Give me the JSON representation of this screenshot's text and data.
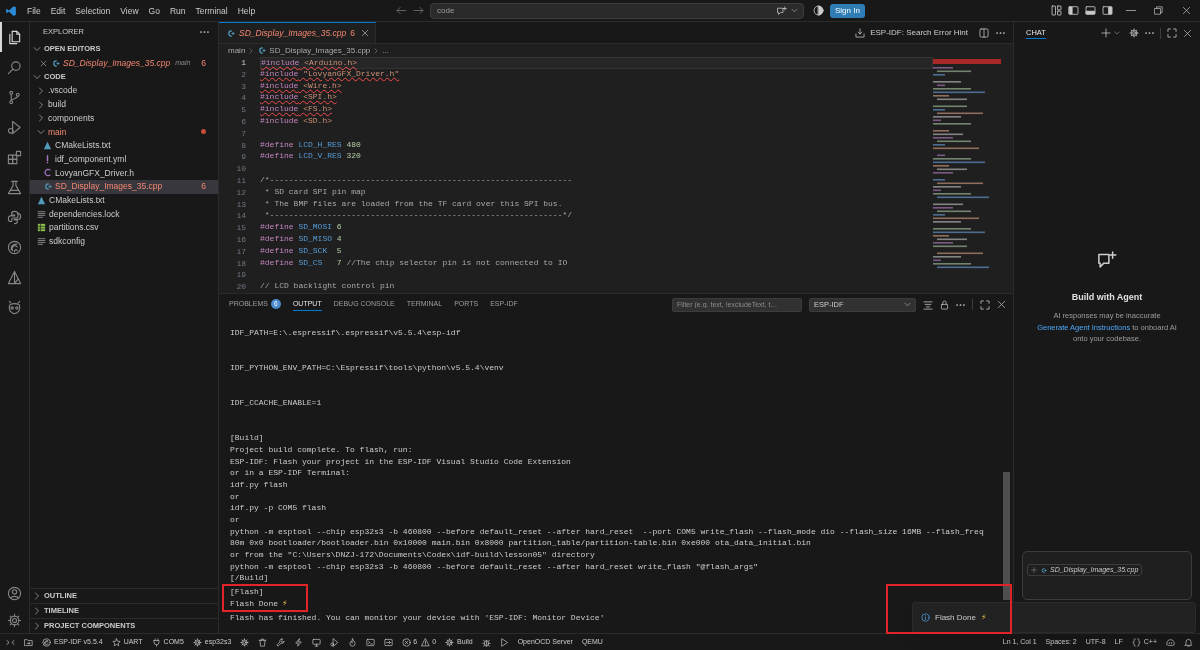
{
  "title_bar": {
    "menu": [
      "File",
      "Edit",
      "Selection",
      "View",
      "Go",
      "Run",
      "Terminal",
      "Help"
    ],
    "command_center": {
      "value": "code"
    },
    "sign_in": "Sign In"
  },
  "activity_bar": {
    "items": [
      {
        "kind": "explorer",
        "selected": true
      },
      {
        "kind": "search",
        "selected": false
      },
      {
        "kind": "source-control",
        "selected": false
      },
      {
        "kind": "run-debug",
        "selected": false
      },
      {
        "kind": "extensions",
        "selected": false
      },
      {
        "kind": "testing",
        "selected": false
      },
      {
        "kind": "python",
        "selected": false
      },
      {
        "kind": "esp-idf",
        "selected": false
      },
      {
        "kind": "cmake",
        "selected": false
      },
      {
        "kind": "alien",
        "selected": false
      }
    ]
  },
  "sidebar": {
    "title": "EXPLORER",
    "sections": [
      {
        "label": "OPEN EDITORS",
        "expanded": true,
        "editors": [
          {
            "name": "SD_Display_Images_35.cpp",
            "kind": "cpp",
            "folder": "main",
            "problems": "6",
            "error": true
          }
        ]
      },
      {
        "label": "CODE",
        "expanded": true,
        "tree": [
          {
            "name": ".vscode",
            "kind": "folder",
            "expanded": false,
            "selected": false,
            "error": false
          },
          {
            "name": "build",
            "kind": "folder",
            "expanded": false,
            "selected": false,
            "error": false
          },
          {
            "name": "components",
            "kind": "folder",
            "expanded": false,
            "selected": false,
            "error": false
          },
          {
            "name": "main",
            "kind": "folder",
            "expanded": true,
            "selected": false,
            "error": true,
            "children": [
              {
                "name": "CMakeLists.txt",
                "kind": "cmake",
                "selected": false,
                "error": false
              },
              {
                "name": "idf_component.yml",
                "kind": "yaml",
                "selected": false,
                "error": false
              },
              {
                "name": "LovyanGFX_Driver.h",
                "kind": "header",
                "selected": false,
                "error": false
              },
              {
                "name": "SD_Display_Images_35.cpp",
                "kind": "cpp",
                "selected": true,
                "error": true,
                "problems": "6"
              }
            ]
          },
          {
            "name": "CMakeLists.txt",
            "kind": "cmake",
            "selected": false,
            "error": false
          },
          {
            "name": "dependencies.lock",
            "kind": "lock",
            "selected": false,
            "error": false
          },
          {
            "name": "partitions.csv",
            "kind": "csv",
            "selected": false,
            "error": false
          },
          {
            "name": "sdkconfig",
            "kind": "config",
            "selected": false,
            "error": false
          }
        ]
      },
      {
        "label": "OUTLINE",
        "expanded": false
      },
      {
        "label": "TIMELINE",
        "expanded": false
      },
      {
        "label": "PROJECT COMPONENTS",
        "expanded": false
      }
    ]
  },
  "editor": {
    "tabs": [
      {
        "label": "SD_Display_Images_35.cpp",
        "kind": "cpp",
        "problems": "6",
        "error": true,
        "selected": true
      }
    ],
    "error_hint": "ESP-IDF: Search Error Hint",
    "breadcrumb": [
      {
        "text": "main",
        "kind": "folder"
      },
      {
        "text": "SD_Display_Images_35.cpp",
        "kind": "cpp"
      },
      {
        "text": "...",
        "kind": "symbol"
      }
    ],
    "lines": [
      {
        "number": "1",
        "selected": true,
        "error": true,
        "tokens": [
          {
            "kind": "directive",
            "text": "#include"
          },
          {
            "kind": "header",
            "text": " <Arduino.h>"
          }
        ]
      },
      {
        "number": "2",
        "selected": false,
        "error": true,
        "tokens": [
          {
            "kind": "directive",
            "text": "#include"
          },
          {
            "kind": "header",
            "text": " \"LovyanGFX_Driver.h\""
          }
        ]
      },
      {
        "number": "3",
        "selected": false,
        "error": true,
        "tokens": [
          {
            "kind": "directive",
            "text": "#include"
          },
          {
            "kind": "header",
            "text": " <Wire.h>"
          }
        ]
      },
      {
        "number": "4",
        "selected": false,
        "error": true,
        "tokens": [
          {
            "kind": "directive",
            "text": "#include"
          },
          {
            "kind": "header",
            "text": " <SPI.h>"
          }
        ]
      },
      {
        "number": "5",
        "selected": false,
        "error": true,
        "tokens": [
          {
            "kind": "directive",
            "text": "#include"
          },
          {
            "kind": "header",
            "text": " <FS.h>"
          }
        ]
      },
      {
        "number": "6",
        "selected": false,
        "error": false,
        "tokens": [
          {
            "kind": "directive",
            "text": "#include"
          },
          {
            "kind": "header",
            "text": " <SD.h>"
          }
        ]
      },
      {
        "number": "7",
        "selected": false
      },
      {
        "number": "8",
        "selected": false,
        "error": false,
        "tokens": [
          {
            "kind": "directive",
            "text": "#define"
          },
          {
            "kind": "macro",
            "text": " LCD_H_RES"
          },
          {
            "kind": "number",
            "text": " 480"
          }
        ]
      },
      {
        "number": "9",
        "selected": false,
        "error": false,
        "tokens": [
          {
            "kind": "directive",
            "text": "#define"
          },
          {
            "kind": "macro",
            "text": " LCD_V_RES"
          },
          {
            "kind": "number",
            "text": " 320"
          }
        ]
      },
      {
        "number": "10",
        "selected": false
      },
      {
        "number": "11",
        "selected": false,
        "error": false,
        "tokens": [
          {
            "kind": "comment",
            "text": "/*---------------------------------------------------------------"
          }
        ]
      },
      {
        "number": "12",
        "selected": false,
        "error": false,
        "tokens": [
          {
            "kind": "comment",
            "text": " * SD card SPI pin map"
          }
        ]
      },
      {
        "number": "13",
        "selected": false,
        "error": false,
        "tokens": [
          {
            "kind": "comment",
            "text": " * The BMP files are loaded from the TF card over this SPI bus."
          }
        ]
      },
      {
        "number": "14",
        "selected": false,
        "error": false,
        "tokens": [
          {
            "kind": "comment",
            "text": " *-------------------------------------------------------------*/"
          }
        ]
      },
      {
        "number": "15",
        "selected": false,
        "error": false,
        "tokens": [
          {
            "kind": "directive",
            "text": "#define"
          },
          {
            "kind": "macro",
            "text": " SD_MOSI"
          },
          {
            "kind": "number",
            "text": " 6"
          }
        ]
      },
      {
        "number": "16",
        "selected": false,
        "error": false,
        "tokens": [
          {
            "kind": "directive",
            "text": "#define"
          },
          {
            "kind": "macro",
            "text": " SD_MISO"
          },
          {
            "kind": "number",
            "text": " 4"
          }
        ]
      },
      {
        "number": "17",
        "selected": false,
        "error": false,
        "tokens": [
          {
            "kind": "directive",
            "text": "#define"
          },
          {
            "kind": "macro",
            "text": " SD_SCK"
          },
          {
            "kind": "number",
            "text": "  5"
          }
        ]
      },
      {
        "number": "18",
        "selected": false,
        "error": false,
        "tokens": [
          {
            "kind": "directive",
            "text": "#define"
          },
          {
            "kind": "macro",
            "text": " SD_CS"
          },
          {
            "kind": "number",
            "text": "   7"
          },
          {
            "kind": "comment",
            "text": " //The chip selector pin is not connected to IO"
          }
        ]
      },
      {
        "number": "19",
        "selected": false
      },
      {
        "number": "20",
        "selected": false,
        "error": false,
        "tokens": [
          {
            "kind": "comment",
            "text": "// LCD backlight control pin"
          }
        ]
      }
    ]
  },
  "panel": {
    "tabs": [
      {
        "label": "PROBLEMS",
        "badge": "6",
        "selected": false
      },
      {
        "label": "OUTPUT",
        "selected": true
      },
      {
        "label": "DEBUG CONSOLE",
        "selected": false
      },
      {
        "label": "TERMINAL",
        "selected": false
      },
      {
        "label": "PORTS",
        "selected": false
      },
      {
        "label": "ESP-IDF",
        "selected": false
      }
    ],
    "filter": {
      "placeholder": "Filter (e.g. text, !excludeText, t…"
    },
    "channel": "ESP-IDF",
    "output": [
      [
        {
          "text": "IDF_PATH=E:\\.espressif\\.espressif\\v5.5.4\\esp-idf",
          "highlighted": false
        }
      ],
      [
        {
          "text": "IDF_PYTHON_ENV_PATH=C:\\Espressif\\tools\\python\\v5.5.4\\venv",
          "highlighted": false
        }
      ],
      [
        {
          "text": "IDF_CCACHE_ENABLE=1",
          "highlighted": false
        }
      ],
      [
        {
          "text": "[Build]",
          "highlighted": false
        },
        {
          "text": "Project build complete. To flash, run:",
          "highlighted": false
        },
        {
          "text": "ESP-IDF: Flash your project in the ESP-IDF Visual Studio Code Extension",
          "highlighted": false
        },
        {
          "text": "or in a ESP-IDF Terminal:",
          "highlighted": false
        },
        {
          "text": "idf.py flash",
          "highlighted": false
        },
        {
          "text": "or",
          "highlighted": false
        },
        {
          "text": "idf.py -p COM5 flash",
          "highlighted": false
        },
        {
          "text": "or",
          "highlighted": false
        },
        {
          "text": "python -m esptool --chip esp32s3 -b 460800 --before default_reset --after hard_reset  --port COM5 write_flash --flash_mode dio --flash_size 16MB --flash_freq",
          "highlighted": false
        },
        {
          "text": "80m 0x0 bootloader/bootloader.bin 0x10000 main.bin 0x8000 partition_table/partition-table.bin 0xe000 ota_data_initial.bin",
          "highlighted": false
        },
        {
          "text": "or from the \"C:\\Users\\DNZJ-172\\Documents\\Codex\\idf-build\\lesson05\" directory",
          "highlighted": false
        },
        {
          "text": "python -m esptool --chip esp32s3 -b 460800 --before default_reset --after hard_reset write_flash \"@flash_args\"",
          "highlighted": false
        },
        {
          "text": "[/Build]",
          "highlighted": false
        },
        {
          "text": "[Flash]",
          "highlighted": true
        },
        {
          "text": "Flash Done",
          "icon": "⚡",
          "highlighted": true
        },
        {
          "text": "Flash has finished. You can monitor your device with 'ESP-IDF: Monitor Device'",
          "highlighted": false
        }
      ]
    ]
  },
  "chat": {
    "tabs": [
      {
        "label": "CHAT",
        "selected": true
      }
    ],
    "title": "Build with Agent",
    "disclaimer": "AI responses may be inaccurate",
    "instructions": {
      "link": "Generate Agent Instructions",
      "text": " to onboard AI onto your codebase."
    },
    "context": [
      {
        "name": "SD_Display_Images_35.cpp",
        "kind": "cpp"
      }
    ]
  },
  "notification": {
    "message": "Flash Done",
    "icon": "⚡",
    "highlighted": true
  },
  "status_bar": {
    "left": [
      {
        "kind": "remote"
      },
      {
        "kind": "folder"
      },
      {
        "kind": "esp-idf",
        "text": "ESP-IDF v5.5.4"
      },
      {
        "kind": "star",
        "text": "UART"
      },
      {
        "kind": "plug",
        "text": "COM5"
      },
      {
        "kind": "gear",
        "text": "esp32s3"
      },
      {
        "kind": "gear"
      },
      {
        "kind": "trash"
      },
      {
        "kind": "wrench"
      },
      {
        "kind": "bolt"
      },
      {
        "kind": "monitor"
      },
      {
        "kind": "run-debug"
      },
      {
        "kind": "flame"
      },
      {
        "kind": "terminal"
      },
      {
        "kind": "export"
      },
      {
        "kind": "problems",
        "errors": "6",
        "warnings": "0"
      },
      {
        "kind": "build",
        "text": "Build"
      },
      {
        "kind": "bug"
      },
      {
        "kind": "play"
      },
      {
        "kind": "text",
        "text": "OpenOCD Server"
      },
      {
        "kind": "text",
        "text": "QEMU"
      }
    ],
    "right": [
      {
        "kind": "text",
        "text": "Ln 1, Col 1"
      },
      {
        "kind": "text",
        "text": "Spaces: 2"
      },
      {
        "kind": "text",
        "text": "UTF-8"
      },
      {
        "kind": "text",
        "text": "LF"
      },
      {
        "kind": "braces",
        "text": "C++"
      },
      {
        "kind": "copilot"
      },
      {
        "kind": "bell"
      }
    ]
  }
}
